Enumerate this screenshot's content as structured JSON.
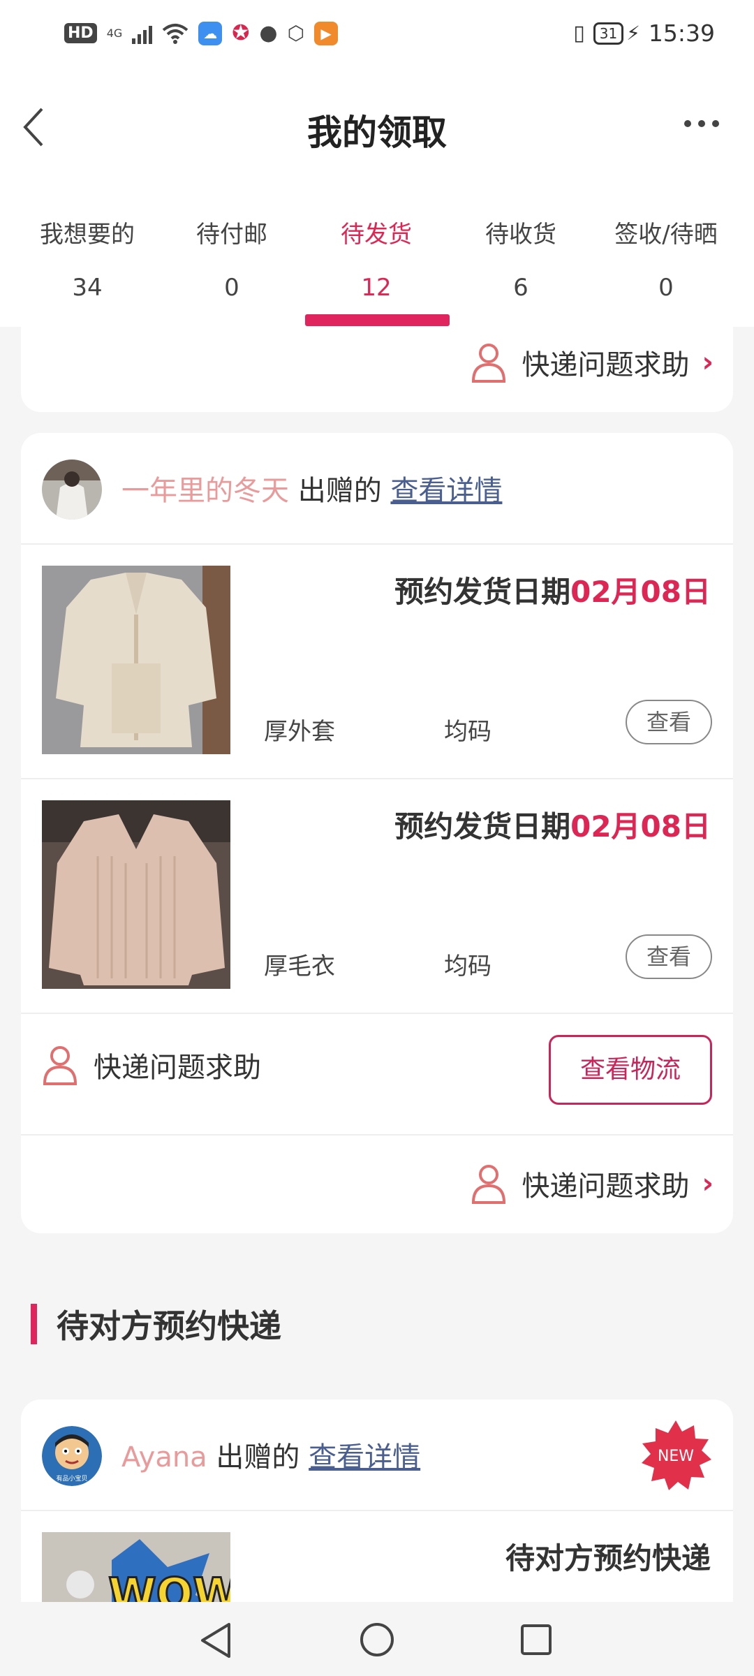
{
  "status_bar": {
    "hd": "HD",
    "network": "4G",
    "battery": "31",
    "time": "15:39"
  },
  "header": {
    "title": "我的领取"
  },
  "tabs": [
    {
      "label": "我想要的",
      "count": "34"
    },
    {
      "label": "待付邮",
      "count": "0"
    },
    {
      "label": "待发货",
      "count": "12"
    },
    {
      "label": "待收货",
      "count": "6"
    },
    {
      "label": "签收/待晒",
      "count": "0"
    }
  ],
  "active_tab_index": 2,
  "top_help": {
    "label": "快递问题求助"
  },
  "order1": {
    "giver_name": "一年里的冬天",
    "gave_text": "出赠的",
    "detail_link": "查看详情",
    "items": [
      {
        "date_label": "预约发货日期",
        "date_value": "02月08日",
        "name": "厚外套",
        "size": "均码",
        "view_label": "查看"
      },
      {
        "date_label": "预约发货日期",
        "date_value": "02月08日",
        "name": "厚毛衣",
        "size": "均码",
        "view_label": "查看"
      }
    ],
    "help_label": "快递问题求助",
    "logistics_label": "查看物流",
    "footer_help_label": "快递问题求助"
  },
  "section": {
    "title": "待对方预约快递"
  },
  "order2": {
    "giver_name": "Ayana",
    "gave_text": "出赠的",
    "detail_link": "查看详情",
    "badge": "NEW",
    "status": "待对方预约快递",
    "avatar_text": "有品小宝贝"
  },
  "colors": {
    "accent": "#e0245e",
    "giver_name": "#e99a9a",
    "link": "#4a5f8f"
  }
}
